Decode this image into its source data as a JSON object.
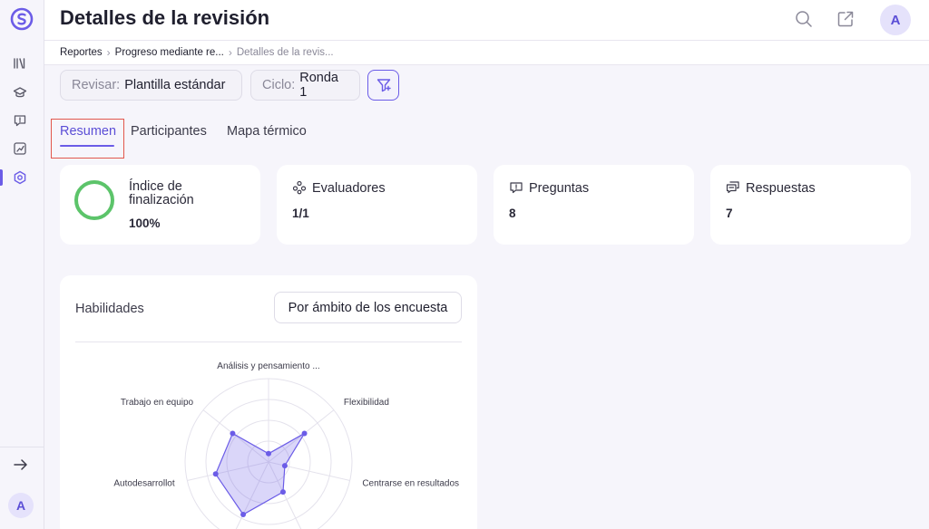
{
  "header": {
    "title": "Detalles de la revisión",
    "avatar_initial": "A"
  },
  "sidebar": {
    "items": [
      {
        "icon": "library-icon"
      },
      {
        "icon": "graduation-cap-icon"
      },
      {
        "icon": "feedback-icon"
      },
      {
        "icon": "chart-icon"
      },
      {
        "icon": "review-cycle-icon",
        "active": true
      }
    ],
    "expand_icon": "arrow-right-icon",
    "avatar_initial": "A"
  },
  "breadcrumb": {
    "items": [
      "Reportes",
      "Progreso mediante re...",
      "Detalles de la revis..."
    ]
  },
  "filters": {
    "review": {
      "label": "Revisar:",
      "value": "Plantilla estándar"
    },
    "cycle": {
      "label": "Ciclo:",
      "value": "Ronda 1"
    }
  },
  "tabs": [
    {
      "label": "Resumen",
      "active": true
    },
    {
      "label": "Participantes"
    },
    {
      "label": "Mapa térmico"
    }
  ],
  "stats": {
    "completion": {
      "title_line1": "Índice de",
      "title_line2": "finalización",
      "value": "100%",
      "progress": 1.0
    },
    "evaluators": {
      "title": "Evaluadores",
      "value": "1/1"
    },
    "questions": {
      "title": "Preguntas",
      "value": "8"
    },
    "answers": {
      "title": "Respuestas",
      "value": "7"
    }
  },
  "skills": {
    "title": "Habilidades",
    "scope_button": "Por ámbito de los encuesta"
  },
  "colors": {
    "accent": "#6b5ce7",
    "progress_ring": "#5cc46a",
    "highlight": "#e2574c"
  },
  "chart_data": {
    "type": "radar",
    "axes": [
      "Análisis y pensamiento ...",
      "Flexibilidad",
      "Centrarse en resultados",
      "",
      "",
      "Autodesarrollot",
      "Trabajo en equipo"
    ],
    "values": [
      0.1,
      0.55,
      0.2,
      0.4,
      0.7,
      0.65,
      0.55
    ],
    "rmax": 1,
    "rings": 4
  }
}
